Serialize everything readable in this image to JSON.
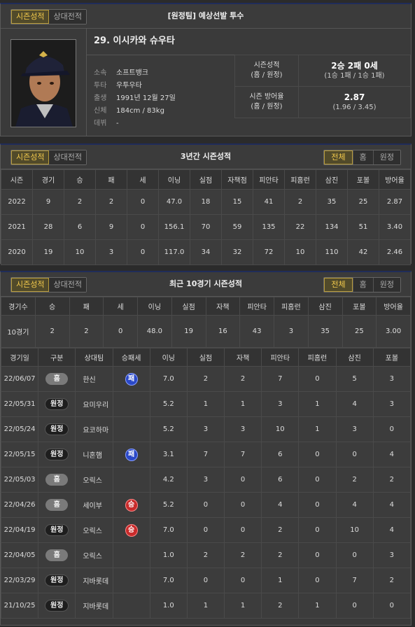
{
  "player_panel": {
    "tabs": [
      "시즌성적",
      "상대전적"
    ],
    "title": "[원정팀] 예상선발 투수",
    "name": "29. 이시카와 슈우타",
    "info": [
      {
        "k": "소속",
        "v": "소프트뱅크"
      },
      {
        "k": "투타",
        "v": "우투우타"
      },
      {
        "k": "출생",
        "v": "1991년 12월 27일"
      },
      {
        "k": "신체",
        "v": "184cm / 83kg"
      },
      {
        "k": "데뷔",
        "v": "-"
      }
    ],
    "summary": [
      {
        "label1": "시즌성적",
        "label2": "(홈 / 원정)",
        "big": "2승 2패 0세",
        "small": "(1승 1패 / 1승 1패)"
      },
      {
        "label1": "시즌 방어율",
        "label2": "(홈 / 원정)",
        "big": "2.87",
        "small": "(1.96 / 3.45)"
      }
    ]
  },
  "three_year": {
    "tabs": [
      "시즌성적",
      "상대전적"
    ],
    "title": "3년간 시즌성적",
    "filters": [
      "전체",
      "홈",
      "원정"
    ],
    "headers": [
      "시즌",
      "경기",
      "승",
      "패",
      "세",
      "이닝",
      "실점",
      "자책점",
      "피안타",
      "피홈런",
      "삼진",
      "포볼",
      "방어율"
    ],
    "rows": [
      [
        "2022",
        "9",
        "2",
        "2",
        "0",
        "47.0",
        "18",
        "15",
        "41",
        "2",
        "35",
        "25",
        "2.87"
      ],
      [
        "2021",
        "28",
        "6",
        "9",
        "0",
        "156.1",
        "70",
        "59",
        "135",
        "22",
        "134",
        "51",
        "3.40"
      ],
      [
        "2020",
        "19",
        "10",
        "3",
        "0",
        "117.0",
        "34",
        "32",
        "72",
        "10",
        "110",
        "42",
        "2.46"
      ]
    ]
  },
  "recent": {
    "tabs": [
      "시즌성적",
      "상대전적"
    ],
    "title": "최근 10경기 시즌성적",
    "filters": [
      "전체",
      "홈",
      "원정"
    ],
    "sum_headers": [
      "경기수",
      "승",
      "패",
      "세",
      "이닝",
      "실점",
      "자책",
      "피안타",
      "피홈런",
      "삼진",
      "포볼",
      "방어율"
    ],
    "sum_row": [
      "10경기",
      "2",
      "2",
      "0",
      "48.0",
      "19",
      "16",
      "43",
      "3",
      "35",
      "25",
      "3.00"
    ],
    "game_headers": [
      "경기일",
      "구분",
      "상대팀",
      "승패세",
      "이닝",
      "실점",
      "자책",
      "피안타",
      "피홈런",
      "삼진",
      "포볼"
    ],
    "games": [
      {
        "date": "22/06/07",
        "type": "홈",
        "opp": "한신",
        "res": "패",
        "ip": "7.0",
        "r": "2",
        "er": "2",
        "h": "7",
        "hr": "0",
        "so": "5",
        "bb": "3"
      },
      {
        "date": "22/05/31",
        "type": "원정",
        "opp": "요미우리",
        "res": "",
        "ip": "5.2",
        "r": "1",
        "er": "1",
        "h": "3",
        "hr": "1",
        "so": "4",
        "bb": "3"
      },
      {
        "date": "22/05/24",
        "type": "원정",
        "opp": "요코하마",
        "res": "",
        "ip": "5.2",
        "r": "3",
        "er": "3",
        "h": "10",
        "hr": "1",
        "so": "3",
        "bb": "0"
      },
      {
        "date": "22/05/15",
        "type": "원정",
        "opp": "니혼햄",
        "res": "패",
        "ip": "3.1",
        "r": "7",
        "er": "7",
        "h": "6",
        "hr": "0",
        "so": "0",
        "bb": "4"
      },
      {
        "date": "22/05/03",
        "type": "홈",
        "opp": "오릭스",
        "res": "",
        "ip": "4.2",
        "r": "3",
        "er": "0",
        "h": "6",
        "hr": "0",
        "so": "2",
        "bb": "2"
      },
      {
        "date": "22/04/26",
        "type": "홈",
        "opp": "세이부",
        "res": "승",
        "ip": "5.2",
        "r": "0",
        "er": "0",
        "h": "4",
        "hr": "0",
        "so": "4",
        "bb": "4"
      },
      {
        "date": "22/04/19",
        "type": "원정",
        "opp": "오릭스",
        "res": "승",
        "ip": "7.0",
        "r": "0",
        "er": "0",
        "h": "2",
        "hr": "0",
        "so": "10",
        "bb": "4"
      },
      {
        "date": "22/04/05",
        "type": "홈",
        "opp": "오릭스",
        "res": "",
        "ip": "1.0",
        "r": "2",
        "er": "2",
        "h": "2",
        "hr": "0",
        "so": "0",
        "bb": "3"
      },
      {
        "date": "22/03/29",
        "type": "원정",
        "opp": "지바롯데",
        "res": "",
        "ip": "7.0",
        "r": "0",
        "er": "0",
        "h": "1",
        "hr": "0",
        "so": "7",
        "bb": "2"
      },
      {
        "date": "21/10/25",
        "type": "원정",
        "opp": "지바롯데",
        "res": "",
        "ip": "1.0",
        "r": "1",
        "er": "1",
        "h": "2",
        "hr": "1",
        "so": "0",
        "bb": "0"
      }
    ]
  }
}
